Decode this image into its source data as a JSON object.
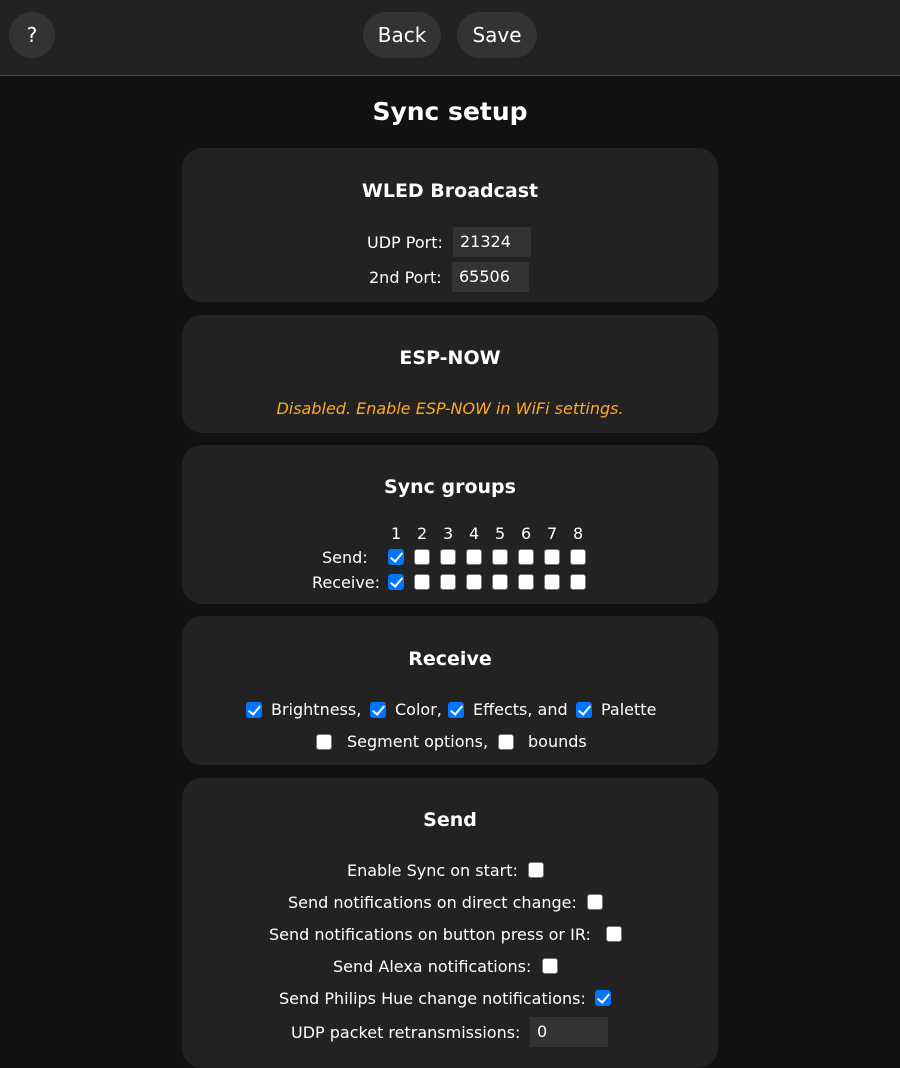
{
  "toolbar": {
    "help_label": "?",
    "back_label": "Back",
    "save_label": "Save"
  },
  "page": {
    "title": "Sync setup"
  },
  "wled_broadcast": {
    "title": "WLED Broadcast",
    "udp_port_label": "UDP Port:",
    "udp_port_value": "21324",
    "second_port_label": "2nd Port:",
    "second_port_value": "65506"
  },
  "esp_now": {
    "title": "ESP-NOW",
    "status_text": "Disabled. Enable ESP-NOW in WiFi settings."
  },
  "sync_groups": {
    "title": "Sync groups",
    "group_numbers": [
      "1",
      "2",
      "3",
      "4",
      "5",
      "6",
      "7",
      "8"
    ],
    "send_label": "Send:",
    "receive_label": "Receive:",
    "send_checked": [
      true,
      false,
      false,
      false,
      false,
      false,
      false,
      false
    ],
    "receive_checked": [
      true,
      false,
      false,
      false,
      false,
      false,
      false,
      false
    ]
  },
  "receive": {
    "title": "Receive",
    "brightness_label": "Brightness,",
    "brightness_checked": true,
    "color_label": "Color,",
    "color_checked": true,
    "effects_label": "Effects, and",
    "effects_checked": true,
    "palette_label": "Palette",
    "palette_checked": true,
    "segment_options_label": "Segment options,",
    "segment_options_checked": false,
    "bounds_label": "bounds",
    "bounds_checked": false
  },
  "send": {
    "title": "Send",
    "enable_sync_label": "Enable Sync on start:",
    "enable_sync_checked": false,
    "direct_change_label": "Send notifications on direct change:",
    "direct_change_checked": false,
    "button_press_label": "Send notifications on button press or IR:",
    "button_press_checked": false,
    "alexa_label": "Send Alexa notifications:",
    "alexa_checked": false,
    "hue_label": "Send Philips Hue change notifications:",
    "hue_checked": true,
    "retransmissions_label": "UDP packet retransmissions:",
    "retransmissions_value": "0"
  },
  "colors": {
    "background": "#111111",
    "card": "#222222",
    "button": "#333333",
    "checkbox_checked": "#0075ff",
    "warning_text": "#ffa726"
  }
}
